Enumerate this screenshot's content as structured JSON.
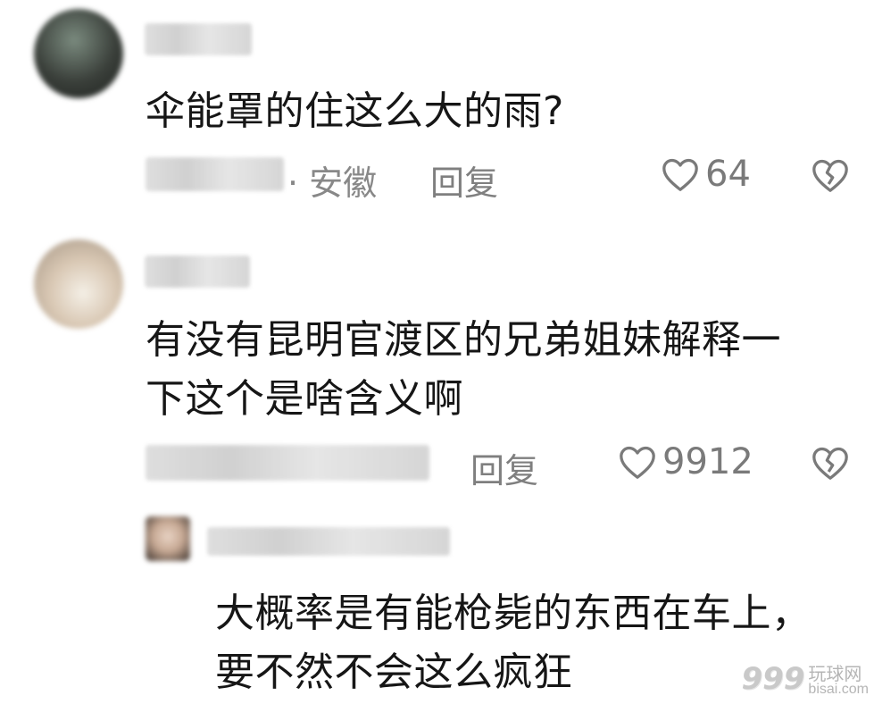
{
  "comments": [
    {
      "text": "伞能罩的住这么大的雨?",
      "location": "· 安徽",
      "reply_label": "回复",
      "likes": "64"
    },
    {
      "text_line1": "有没有昆明官渡区的兄弟姐妹解释一",
      "text_line2": "下这个是啥含义啊",
      "reply_label": "回复",
      "likes": "9912"
    }
  ],
  "reply": {
    "text_line1": "大概率是有能枪毙的东西在车上，",
    "text_line2": "要不然不会这么疯狂"
  },
  "icons": {
    "like": "heart-outline-icon",
    "dislike": "broken-heart-icon"
  },
  "watermark": {
    "number": "999",
    "cn": "玩球网",
    "en": "bisai.com"
  }
}
